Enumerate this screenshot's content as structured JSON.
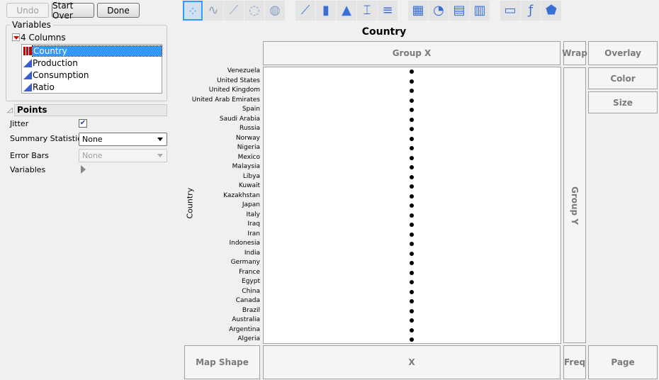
{
  "buttons": {
    "undo": "Undo",
    "start_over": "Start Over",
    "done": "Done"
  },
  "variables": {
    "title": "Variables",
    "columns_label": "4 Columns",
    "items": [
      {
        "label": "Country",
        "type": "nominal",
        "selected": true
      },
      {
        "label": "Production",
        "type": "continuous"
      },
      {
        "label": "Consumption",
        "type": "continuous"
      },
      {
        "label": "Ratio",
        "type": "continuous"
      }
    ]
  },
  "points": {
    "title": "Points",
    "jitter_label": "Jitter",
    "jitter_checked": true,
    "summary_label": "Summary Statistic",
    "summary_value": "None",
    "error_bars_label": "Error Bars",
    "error_bars_value": "None",
    "variables_label": "Variables"
  },
  "toolbar": [
    "points",
    "smoother",
    "line-of-fit",
    "ellipse",
    "contour",
    "line",
    "bar",
    "area",
    "box-plot",
    "histogram",
    "heatmap",
    "pie",
    "treemap",
    "mosaic",
    "caption-box",
    "formula",
    "map-shapes"
  ],
  "graph": {
    "title": "Country",
    "y_label": "Country",
    "categories": [
      "Venezuela",
      "United States",
      "United Kingdom",
      "United Arab Emirates",
      "Spain",
      "Saudi Arabia",
      "Russia",
      "Norway",
      "Nigeria",
      "Mexico",
      "Malaysia",
      "Libya",
      "Kuwait",
      "Kazakhstan",
      "Japan",
      "Italy",
      "Iraq",
      "Iran",
      "Indonesia",
      "India",
      "Germany",
      "France",
      "Egypt",
      "China",
      "Canada",
      "Brazil",
      "Australia",
      "Argentina",
      "Algeria"
    ]
  },
  "zones": {
    "group_x": "Group X",
    "group_y": "Group Y",
    "wrap": "Wrap",
    "overlay": "Overlay",
    "color": "Color",
    "size": "Size",
    "map_shape": "Map Shape",
    "x": "X",
    "freq": "Freq",
    "page": "Page"
  }
}
